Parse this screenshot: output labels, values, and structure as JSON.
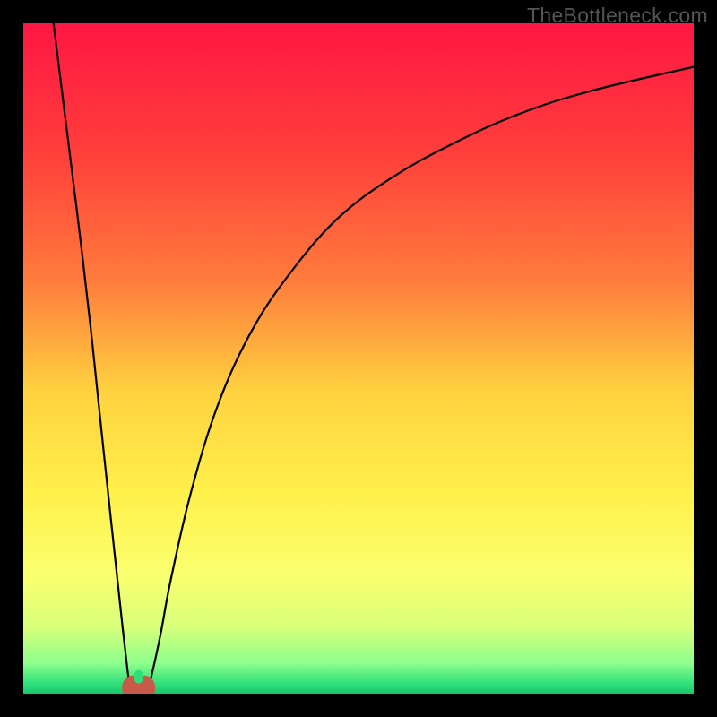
{
  "watermark": "TheBottleneck.com",
  "chart_data": {
    "type": "line",
    "title": "",
    "xlabel": "",
    "ylabel": "",
    "xlim": [
      0,
      100
    ],
    "ylim": [
      0,
      100
    ],
    "gradient_stops": [
      {
        "offset": 0.0,
        "color": "#ff1744"
      },
      {
        "offset": 0.18,
        "color": "#ff3b3b"
      },
      {
        "offset": 0.38,
        "color": "#ff7a3c"
      },
      {
        "offset": 0.55,
        "color": "#ffd23f"
      },
      {
        "offset": 0.7,
        "color": "#fff04a"
      },
      {
        "offset": 0.82,
        "color": "#fbff6e"
      },
      {
        "offset": 0.9,
        "color": "#d8ff7a"
      },
      {
        "offset": 0.955,
        "color": "#8cff8c"
      },
      {
        "offset": 0.985,
        "color": "#2fe07a"
      },
      {
        "offset": 1.0,
        "color": "#18c76a"
      }
    ],
    "series": [
      {
        "name": "left-branch",
        "x": [
          4.5,
          6,
          8,
          10,
          12,
          13.5,
          14.8,
          15.6,
          16.0
        ],
        "y": [
          100,
          88,
          72,
          55,
          36,
          22,
          10,
          3,
          0.5
        ]
      },
      {
        "name": "right-branch",
        "x": [
          18.5,
          19.2,
          20.5,
          22,
          25,
          29,
          34,
          40,
          47,
          55,
          64,
          74,
          85,
          100
        ],
        "y": [
          0.5,
          3,
          9,
          17,
          30,
          43,
          54,
          63,
          71,
          77,
          82,
          86.5,
          90,
          93.5
        ]
      }
    ],
    "marker": {
      "name": "cusp-marker",
      "cx": 17.2,
      "cy": 0.9,
      "type": "double-lobe",
      "color": "#c85a4a",
      "rx": 1.6,
      "ry": 1.8
    }
  }
}
